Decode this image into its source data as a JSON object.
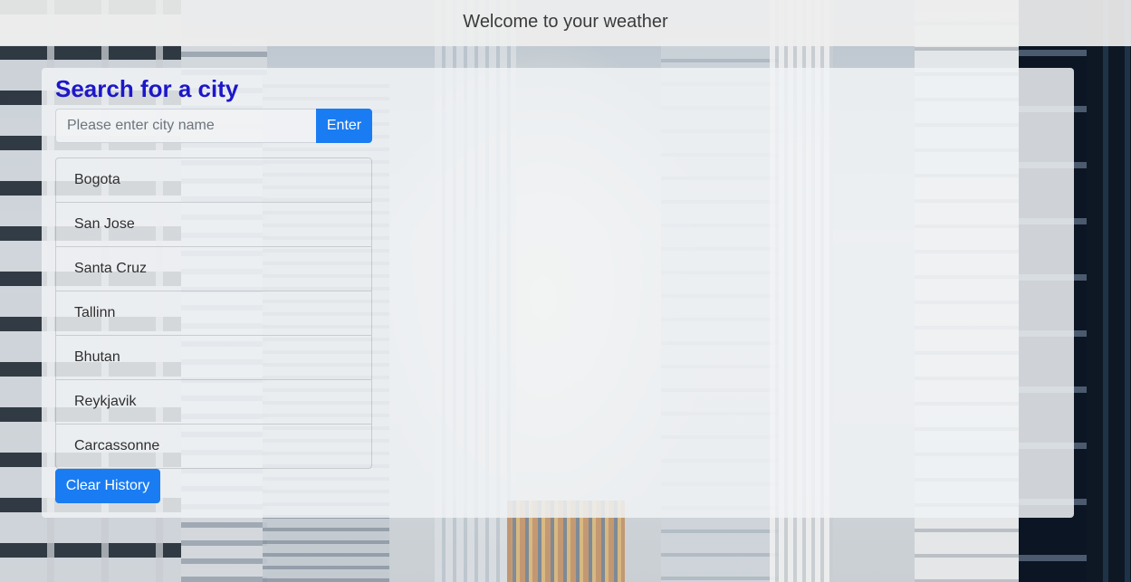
{
  "header": {
    "title": "Welcome to your weather"
  },
  "search": {
    "heading": "Search for a city",
    "placeholder": "Please enter city name",
    "value": "",
    "enter_label": "Enter"
  },
  "history": {
    "items": [
      {
        "label": "Bogota"
      },
      {
        "label": "San Jose"
      },
      {
        "label": "Santa Cruz"
      },
      {
        "label": "Tallinn"
      },
      {
        "label": "Bhutan"
      },
      {
        "label": "Reykjavik"
      },
      {
        "label": "Carcassonne"
      }
    ],
    "clear_label": "Clear History"
  },
  "colors": {
    "heading": "#1c17c9",
    "button": "#1a7cf2"
  }
}
